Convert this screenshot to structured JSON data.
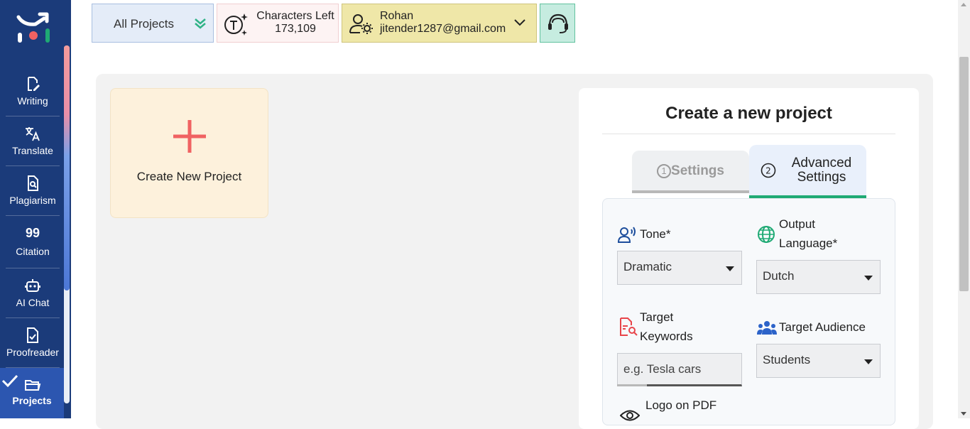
{
  "sidebar": {
    "items": [
      {
        "label": "Writing",
        "icon": "edit-document-icon"
      },
      {
        "label": "Translate",
        "icon": "translate-icon"
      },
      {
        "label": "Plagiarism",
        "icon": "plagiarism-search-icon"
      },
      {
        "label": "Citation",
        "icon": "quote-icon",
        "glyph": "99"
      },
      {
        "label": "AI Chat",
        "icon": "robot-icon"
      },
      {
        "label": "Proofreader",
        "icon": "check-document-icon"
      },
      {
        "label": "Projects",
        "icon": "folder-icon",
        "active": true
      }
    ]
  },
  "topbar": {
    "projects_filter": "All Projects",
    "characters_label": "Characters Left",
    "characters_value": "173,109",
    "user_name": "Rohan",
    "user_email": "jitender1287@gmail.com"
  },
  "main": {
    "create_new_label": "Create New Project"
  },
  "panel": {
    "title": "Create a new project",
    "tabs": [
      {
        "label": "Settings",
        "num": "1",
        "active": false
      },
      {
        "label": "Advanced Settings",
        "num": "2",
        "active": true
      }
    ],
    "tone": {
      "label": "Tone*",
      "value": "Dramatic"
    },
    "output_language": {
      "label": "Output Language*",
      "value": "Dutch"
    },
    "target_keywords": {
      "label": "Target Keywords",
      "placeholder": "e.g. Tesla cars"
    },
    "target_audience": {
      "label": "Target Audience",
      "value": "Students"
    },
    "logo_on_pdf": {
      "label": "Logo on PDF"
    }
  },
  "colors": {
    "sidebar_bg": "#1b3b7a",
    "accent_green": "#1faa74",
    "plus_red": "#f06262"
  }
}
